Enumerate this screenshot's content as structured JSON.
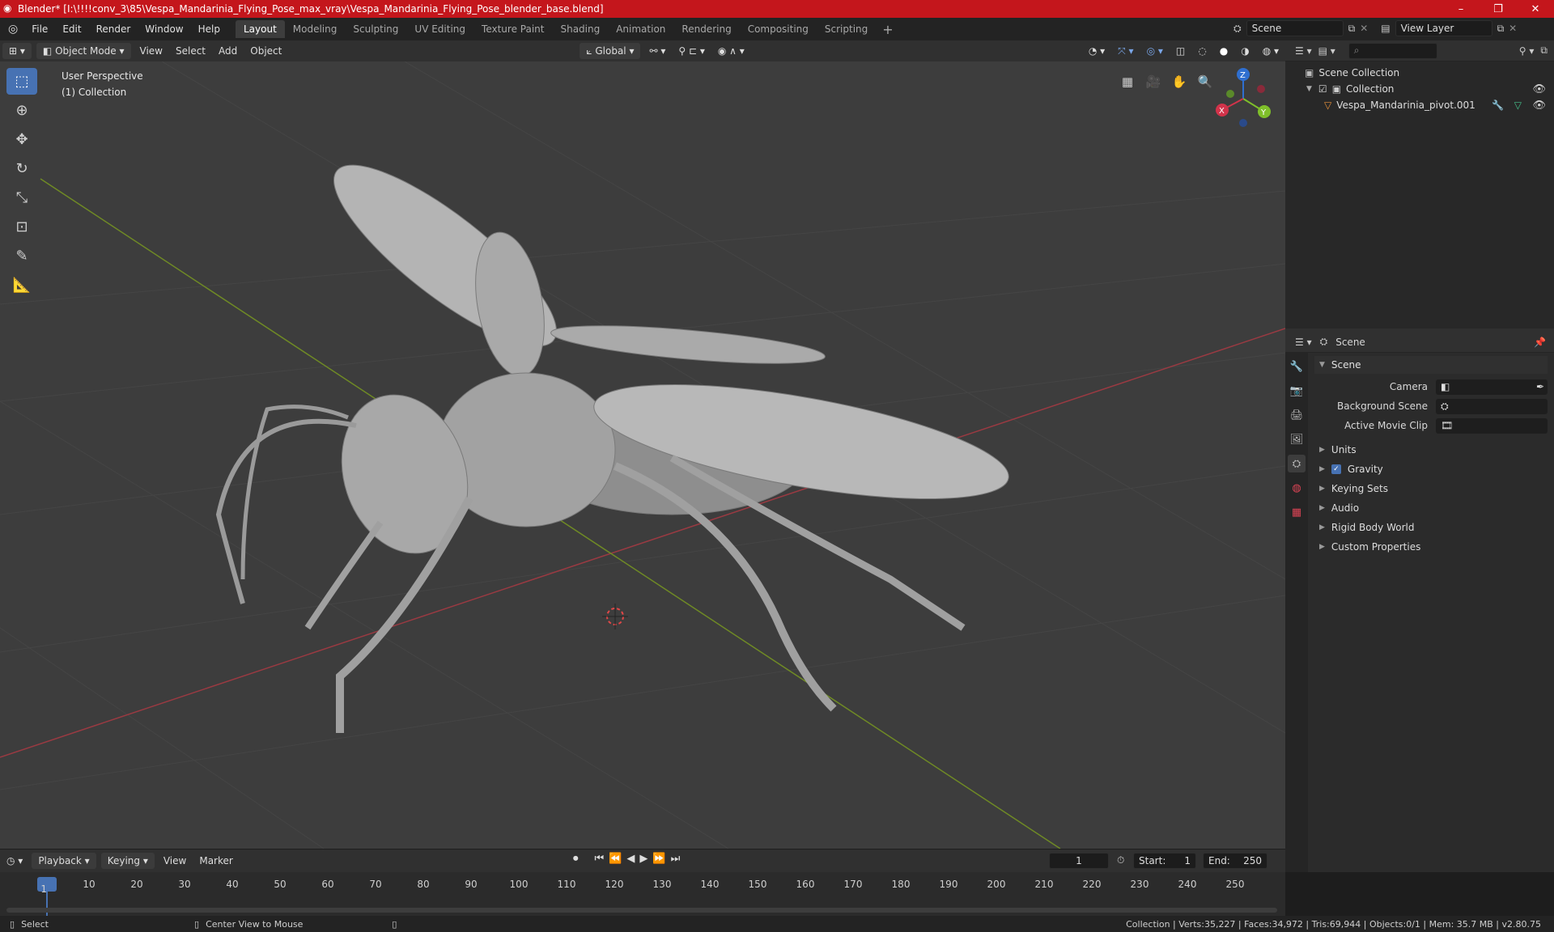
{
  "window": {
    "title": "Blender* [I:\\!!!!conv_3\\85\\Vespa_Mandarinia_Flying_Pose_max_vray\\Vespa_Mandarinia_Flying_Pose_blender_base.blend]"
  },
  "menu": [
    "File",
    "Edit",
    "Render",
    "Window",
    "Help"
  ],
  "workspaces": [
    "Layout",
    "Modeling",
    "Sculpting",
    "UV Editing",
    "Texture Paint",
    "Shading",
    "Animation",
    "Rendering",
    "Compositing",
    "Scripting"
  ],
  "scene_name": "Scene",
  "view_layer": "View Layer",
  "viewport_header": {
    "mode": "Object Mode",
    "menus": [
      "View",
      "Select",
      "Add",
      "Object"
    ],
    "transform": "Global"
  },
  "viewport_info": {
    "perspective": "User Perspective",
    "collection": "(1) Collection"
  },
  "gizmo": {
    "z": "Z",
    "y": "Y",
    "x": "X"
  },
  "outliner": {
    "scene_collection": "Scene Collection",
    "collection": "Collection",
    "object": "Vespa_Mandarinia_pivot.001"
  },
  "properties": {
    "context": "Scene",
    "section": "Scene",
    "rows": [
      {
        "label": "Camera"
      },
      {
        "label": "Background Scene"
      },
      {
        "label": "Active Movie Clip"
      }
    ],
    "subsections": [
      "Units",
      "Gravity",
      "Keying Sets",
      "Audio",
      "Rigid Body World",
      "Custom Properties"
    ]
  },
  "timeline": {
    "menus": [
      "Playback",
      "Keying",
      "View",
      "Marker"
    ],
    "current": "1",
    "start_label": "Start:",
    "start": "1",
    "end_label": "End:",
    "end": "250",
    "ticks": [
      "10",
      "20",
      "30",
      "40",
      "50",
      "60",
      "70",
      "80",
      "90",
      "100",
      "110",
      "120",
      "130",
      "140",
      "150",
      "160",
      "170",
      "180",
      "190",
      "200",
      "210",
      "220",
      "230",
      "240",
      "250"
    ]
  },
  "status": {
    "select": "Select",
    "center": "Center View to Mouse",
    "stats": "Collection | Verts:35,227 | Faces:34,972 | Tris:69,944 | Objects:0/1 | Mem: 35.7 MB | v2.80.75"
  }
}
